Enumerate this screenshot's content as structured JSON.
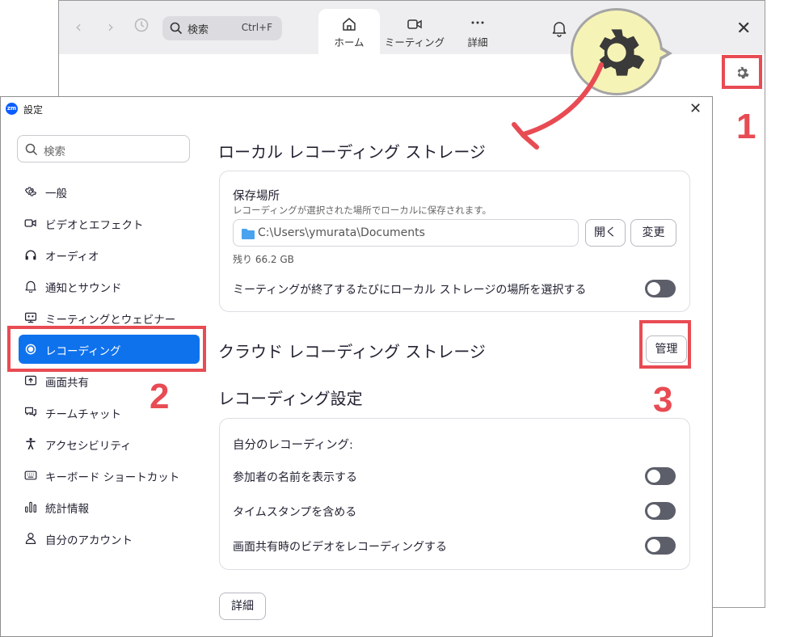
{
  "main_window": {
    "search": {
      "placeholder": "検索",
      "shortcut": "Ctrl+F"
    },
    "nav": [
      {
        "label": "ホーム",
        "icon": "home-icon",
        "active": true
      },
      {
        "label": "ミーティング",
        "icon": "video-camera-icon",
        "active": false
      },
      {
        "label": "詳細",
        "icon": "more-dots-icon",
        "active": false
      }
    ]
  },
  "steps": {
    "one": "1",
    "two": "2",
    "three": "3"
  },
  "dialog": {
    "logo": "zm",
    "title": "設定",
    "sidebar": {
      "search_placeholder": "検索",
      "items": [
        {
          "label": "一般",
          "icon": "gear-icon"
        },
        {
          "label": "ビデオとエフェクト",
          "icon": "video-camera-icon"
        },
        {
          "label": "オーディオ",
          "icon": "headphones-icon"
        },
        {
          "label": "通知とサウンド",
          "icon": "bell-icon"
        },
        {
          "label": "ミーティングとウェビナー",
          "icon": "presentation-icon"
        },
        {
          "label": "レコーディング",
          "icon": "record-icon",
          "active": true
        },
        {
          "label": "画面共有",
          "icon": "share-screen-icon"
        },
        {
          "label": "チームチャット",
          "icon": "chat-icon"
        },
        {
          "label": "アクセシビリティ",
          "icon": "accessibility-icon"
        },
        {
          "label": "キーボード ショートカット",
          "icon": "keyboard-icon"
        },
        {
          "label": "統計情報",
          "icon": "statistics-icon"
        },
        {
          "label": "自分のアカウント",
          "icon": "account-icon"
        }
      ]
    },
    "local_storage": {
      "title": "ローカル レコーディング ストレージ",
      "location_label": "保存場所",
      "location_desc": "レコーディングが選択された場所でローカルに保存されます。",
      "path": "C:\\Users\\ymurata\\Documents",
      "open_button": "開く",
      "change_button": "変更",
      "remaining": "残り 66.2 GB",
      "choose_each_time": {
        "label": "ミーティングが終了するたびにローカル ストレージの場所を選択する",
        "on": false
      }
    },
    "cloud_storage": {
      "title": "クラウド レコーディング ストレージ",
      "manage_button": "管理"
    },
    "recording_settings": {
      "title": "レコーディング設定",
      "group_label": "自分のレコーディング:",
      "options": [
        {
          "label": "参加者の名前を表示する",
          "on": false
        },
        {
          "label": "タイムスタンプを含める",
          "on": false
        },
        {
          "label": "画面共有時のビデオをレコーディングする",
          "on": false
        }
      ],
      "details_button": "詳細"
    }
  },
  "colors": {
    "accent": "#0e72ed",
    "annotation": "#e84b53",
    "bubble": "#f6f3b6",
    "toggle_off": "#5c5f6a"
  }
}
